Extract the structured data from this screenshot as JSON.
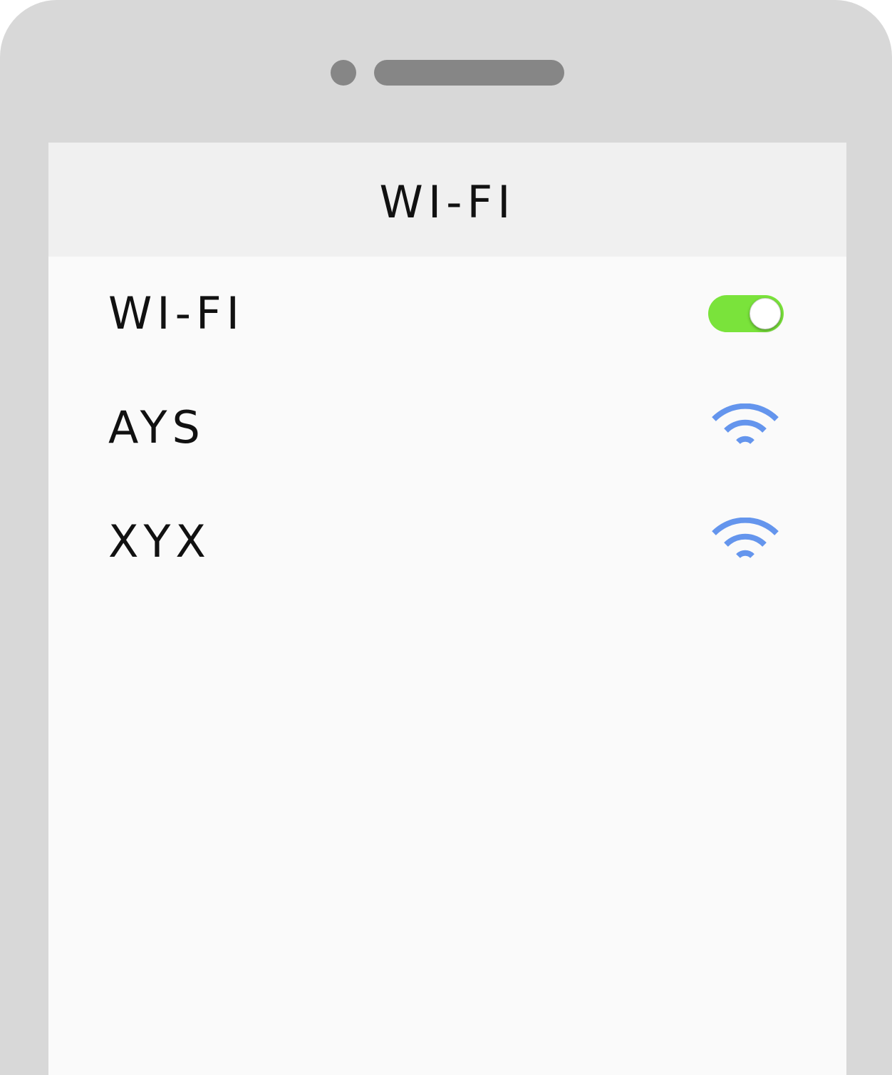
{
  "header": {
    "title": "WI-FI"
  },
  "settings": {
    "wifi_label": "WI-FI",
    "wifi_enabled": true,
    "toggle_color": "#7ae33b"
  },
  "networks": [
    {
      "name": "AYS",
      "icon": "wifi-signal-icon",
      "icon_color": "#6495ed"
    },
    {
      "name": "XYX",
      "icon": "wifi-signal-icon",
      "icon_color": "#6495ed"
    }
  ]
}
